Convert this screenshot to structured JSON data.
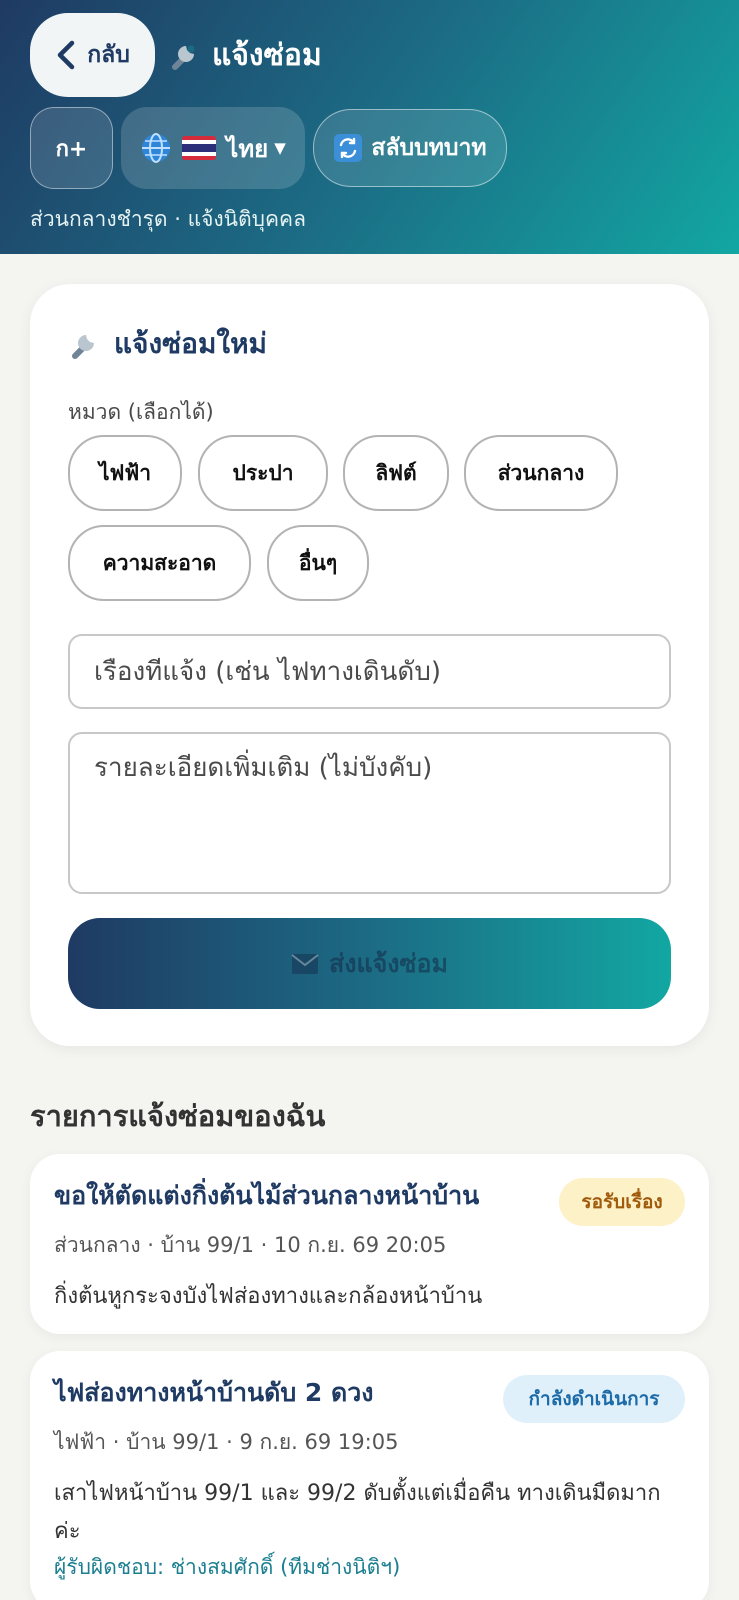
{
  "header": {
    "back_label": "กลับ",
    "title": "แจ้งซ่อม",
    "font_size_label": "ก+",
    "language_label": "ไทย",
    "role_switch_label": "สลับบทบาท",
    "subtitle": "ส่วนกลางชำรุด · แจ้งนิติบุคคล",
    "gradient_colors": [
      "#1f3a63",
      "#1c6b84",
      "#12a7a2"
    ]
  },
  "form": {
    "title": "แจ้งซ่อมใหม่",
    "category_label": "หมวด (เลือกได้)",
    "categories": [
      "ไฟฟ้า",
      "ประปา",
      "ลิฟต์",
      "ส่วนกลาง",
      "ความสะอาด",
      "อื่นๆ"
    ],
    "title_placeholder": "เรืองทีแจ้ง (เช่น ไฟทางเดินดับ)",
    "detail_placeholder": "รายละเอียดเพิ่มเติม (ไม่บังคับ)",
    "submit_label": "ส่งแจ้งซ่อม"
  },
  "reports": {
    "section_title": "รายการแจ้งซ่อมของฉัน",
    "items": [
      {
        "title": "ขอให้ตัดแต่งกิ่งต้นไม้ส่วนกลางหน้าบ้าน",
        "status": "รอรับเรื่อง",
        "meta": "ส่วนกลาง · บ้าน 99/1 · 10 ก.ย. 69 20:05",
        "description": "กิ่งต้นหูกระจงบังไฟส่องทางและกล้องหน้าบ้าน"
      },
      {
        "title": "ไฟส่องทางหน้าบ้านดับ 2 ดวง",
        "status": "กำลังดำเนินการ",
        "meta": "ไฟฟ้า · บ้าน 99/1 · 9 ก.ย. 69 19:05",
        "description": "เสาไฟหน้าบ้าน 99/1 และ 99/2 ดับตั้งแต่เมื่อคืน ทางเดินมืดมากค่ะ",
        "assignee": "ผู้รับผิดชอบ: ช่างสมศักดิ์ (ทีมช่างนิติฯ)"
      }
    ]
  },
  "icons": {
    "back": "chevron-left-icon",
    "wrench": "wrench-icon",
    "globe": "globe-icon",
    "flag": "thailand-flag-icon",
    "swap": "swap-icon",
    "mail": "envelope-icon"
  },
  "status_colors": {
    "pending_bg": "#fdf1c7",
    "pending_text": "#a05a0b",
    "progress_bg": "#e0f0fb",
    "progress_text": "#1c6ba8"
  }
}
